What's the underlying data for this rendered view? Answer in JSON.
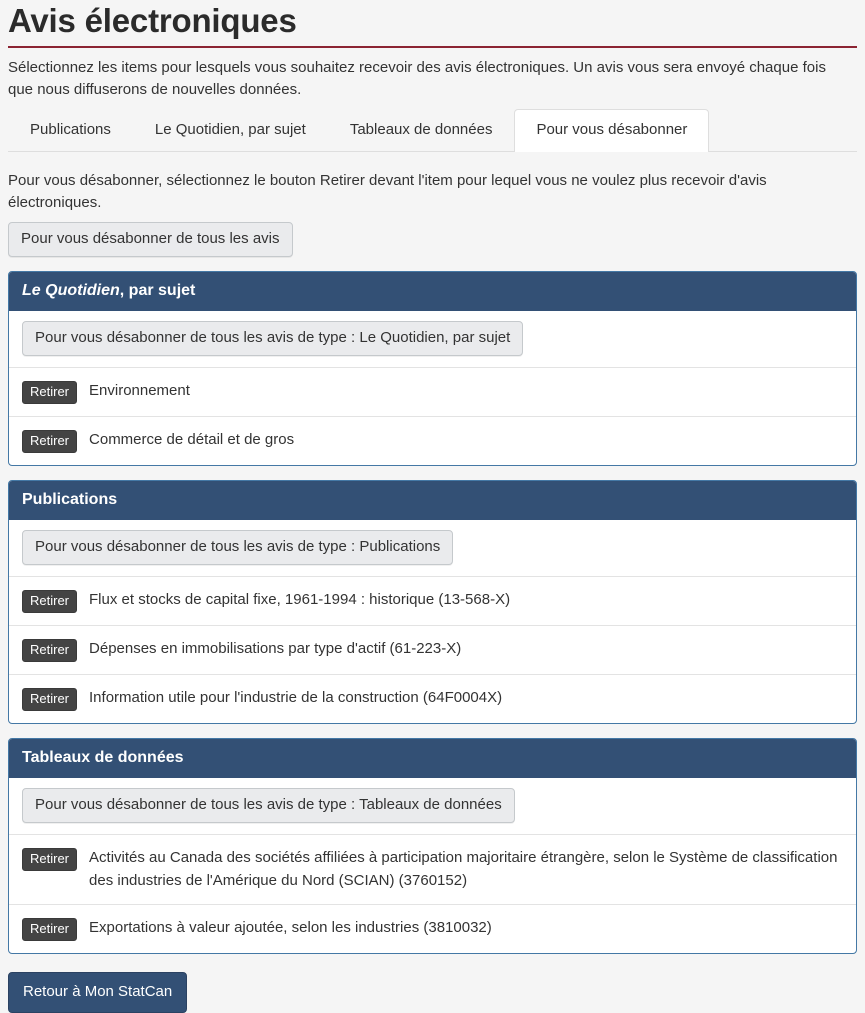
{
  "page": {
    "title": "Avis électroniques",
    "intro": "Sélectionnez les items pour lesquels vous souhaitez recevoir des avis électroniques. Un avis vous sera envoyé chaque fois que nous diffuserons de nouvelles données.",
    "unsubscribe_instructions": "Pour vous désabonner, sélectionnez le bouton Retirer devant l'item pour lequel vous ne voulez plus recevoir d'avis électroniques.",
    "unsubscribe_all_label": "Pour vous désabonner de tous les avis",
    "back_label": "Retour à Mon StatCan",
    "accent_color": "#335075",
    "title_rule_color": "#8b2332",
    "remove_button_color": "#444444"
  },
  "tabs": [
    {
      "label": "Publications",
      "active": false
    },
    {
      "label": "Le Quotidien, par sujet",
      "active": false
    },
    {
      "label": "Tableaux de données",
      "active": false
    },
    {
      "label": "Pour vous désabonner",
      "active": true
    }
  ],
  "panels": [
    {
      "title_italic": "Le Quotidien",
      "title_rest": ", par sujet",
      "unsubscribe_group_label": "Pour vous désabonner de tous les avis de type : Le Quotidien, par sujet",
      "rows": [
        {
          "remove_label": "Retirer",
          "label": "Environnement"
        },
        {
          "remove_label": "Retirer",
          "label": "Commerce de détail et de gros"
        }
      ]
    },
    {
      "title_italic": "",
      "title_rest": "Publications",
      "unsubscribe_group_label": "Pour vous désabonner de tous les avis de type : Publications",
      "rows": [
        {
          "remove_label": "Retirer",
          "label": "Flux et stocks de capital fixe, 1961-1994 : historique (13-568-X)"
        },
        {
          "remove_label": "Retirer",
          "label": "Dépenses en immobilisations par type d'actif (61-223-X)"
        },
        {
          "remove_label": "Retirer",
          "label": "Information utile pour l'industrie de la construction (64F0004X)"
        }
      ]
    },
    {
      "title_italic": "",
      "title_rest": "Tableaux de données",
      "unsubscribe_group_label": "Pour vous désabonner de tous les avis de type : Tableaux de données",
      "rows": [
        {
          "remove_label": "Retirer",
          "label": "Activités au Canada des sociétés affiliées à participation majoritaire étrangère, selon le Système de classification des industries de l'Amérique du Nord (SCIAN) (3760152)"
        },
        {
          "remove_label": "Retirer",
          "label": "Exportations à valeur ajoutée, selon les industries (3810032)"
        }
      ]
    }
  ]
}
